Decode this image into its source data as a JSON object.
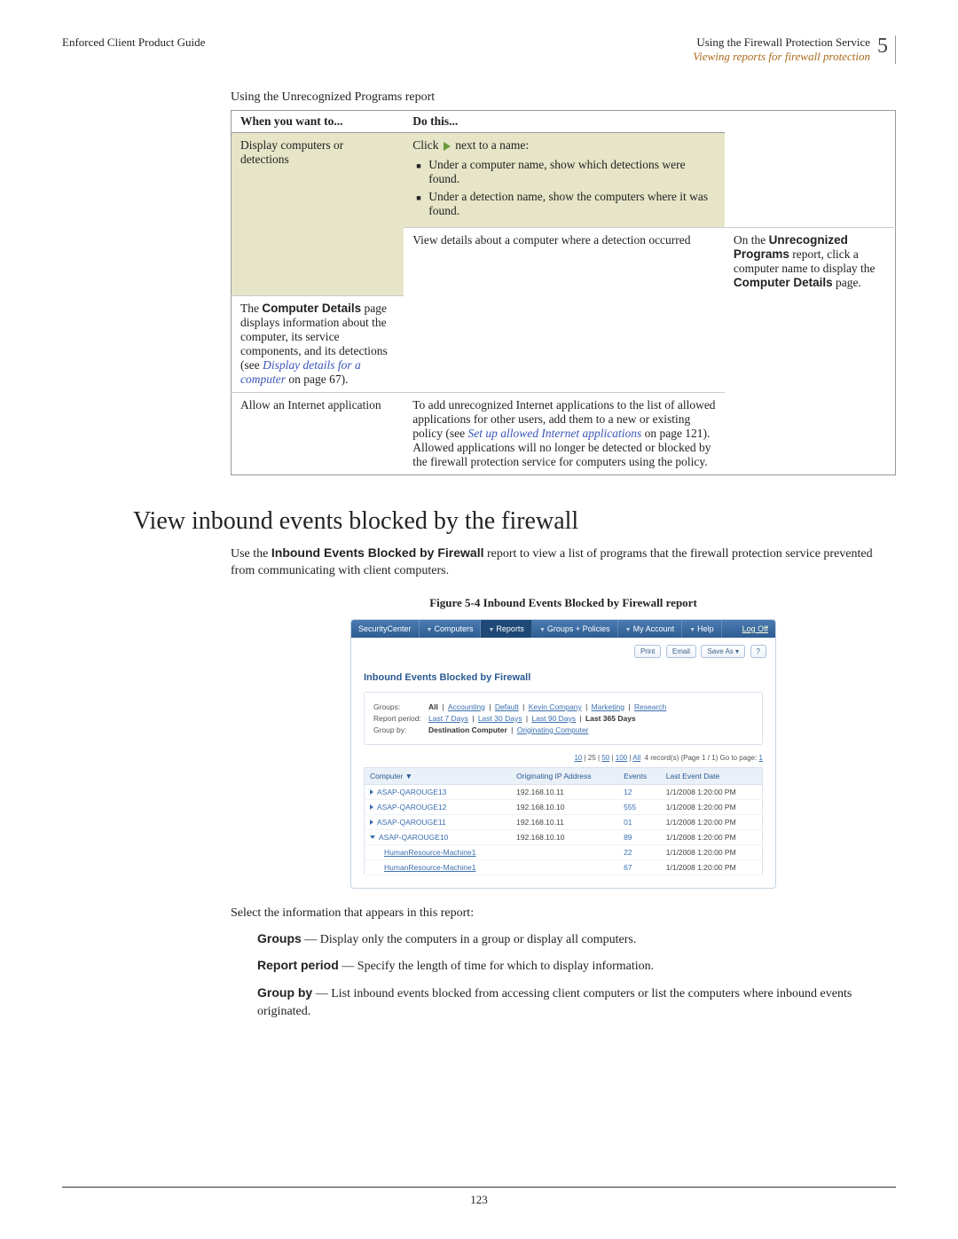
{
  "header": {
    "left": "Enforced Client Product Guide",
    "rightLine1": "Using the Firewall Protection Service",
    "rightLine2": "Viewing reports for firewall protection",
    "chapterNumber": "5"
  },
  "tableIntro": "Using the Unrecognized Programs report",
  "tableHeaders": {
    "c1": "When you want to...",
    "c2": "Do this..."
  },
  "row1": {
    "when": "Display computers or detections",
    "doFirstPre": "Click ",
    "doFirstPost": " next to a name:",
    "b1": "Under a computer name, show which detections were found.",
    "b2": "Under a detection name, show the computers where it was found."
  },
  "row2": {
    "when": "View details about a computer where a detection occurred",
    "p1a": "On the ",
    "p1b": "Unrecognized Programs",
    "p1c": " report, click a computer name to display the ",
    "p1d": "Computer Details",
    "p1e": " page.",
    "p2a": "The ",
    "p2b": "Computer Details",
    "p2c": " page displays information about the computer, its service components, and its detections (see ",
    "p2link": "Display details for a computer",
    "p2d": " on page 67)."
  },
  "row3": {
    "when": "Allow an Internet application",
    "p1a": "To add unrecognized Internet applications to the list of allowed applications for other users, add them to a new or existing policy (see ",
    "p1link": "Set up allowed Internet applications",
    "p1b": " on page 121). Allowed applications will no longer be detected or blocked by the firewall protection service for computers using the policy."
  },
  "sectionTitle": "View inbound events blocked by the firewall",
  "sectionPara": {
    "pre": "Use the ",
    "bold": "Inbound Events Blocked by Firewall",
    "post": " report to view a list of programs that the firewall protection service prevented from communicating with client computers."
  },
  "figCaption": "Figure 5-4  Inbound Events Blocked by Firewall report",
  "screenshot": {
    "nav": [
      "SecurityCenter",
      "Computers",
      "Reports",
      "Groups + Policies",
      "My Account",
      "Help"
    ],
    "navActiveIndex": 2,
    "logoff": "Log Off",
    "buttons": [
      "Print",
      "Email",
      "Save As ▾",
      "?"
    ],
    "title": "Inbound Events Blocked by Firewall",
    "filters": {
      "groupsLabel": "Groups:",
      "groups": [
        "All",
        "Accounting",
        "Default",
        "Kevin Company",
        "Marketing",
        "Research"
      ],
      "groupsSel": 0,
      "periodLabel": "Report period:",
      "periods": [
        "Last 7 Days",
        "Last 30 Days",
        "Last 90 Days",
        "Last 365 Days"
      ],
      "periodsSel": 3,
      "groupbyLabel": "Group by:",
      "groupby": [
        "Destination Computer",
        "Originating Computer"
      ],
      "groupbySel": 0
    },
    "pager": {
      "sizes": [
        "10",
        "25",
        "50",
        "100",
        "All"
      ],
      "text": "4 record(s) (Page 1 / 1)  Go to page:",
      "page": "1"
    },
    "cols": [
      "Computer ▼",
      "Originating IP Address",
      "Events",
      "Last Event Date"
    ],
    "rows": [
      {
        "exp": "r",
        "c": "ASAP-QAROUGE13",
        "ip": "192.168.10.11",
        "ev": "12",
        "d": "1/1/2008 1:20:00 PM"
      },
      {
        "exp": "r",
        "c": "ASAP-QAROUGE12",
        "ip": "192.168.10.10",
        "ev": "555",
        "d": "1/1/2008 1:20:00 PM"
      },
      {
        "exp": "r",
        "c": "ASAP-QAROUGE11",
        "ip": "192.168.10.11",
        "ev": "01",
        "d": "1/1/2008 1:20:00 PM"
      },
      {
        "exp": "d",
        "c": "ASAP-QAROUGE10",
        "ip": "192.168.10.10",
        "ev": "89",
        "d": "1/1/2008 1:20:00 PM"
      },
      {
        "indent": true,
        "c": "HumanResource-Machine1",
        "ip": "",
        "ev": "22",
        "d": "1/1/2008 1:20:00 PM"
      },
      {
        "indent": true,
        "c": "HumanResource-Machine1",
        "ip": "",
        "ev": "67",
        "d": "1/1/2008 1:20:00 PM"
      }
    ]
  },
  "defs": {
    "lead": "Select the information that appears in this report:",
    "items": [
      {
        "term": "Groups",
        "text": " — Display only the computers in a group or display all computers."
      },
      {
        "term": "Report period",
        "text": " — Specify the length of time for which to display information."
      },
      {
        "term": "Group by",
        "text": " — List inbound events blocked from accessing client computers or list the computers where inbound events originated."
      }
    ]
  },
  "pageNumber": "123"
}
